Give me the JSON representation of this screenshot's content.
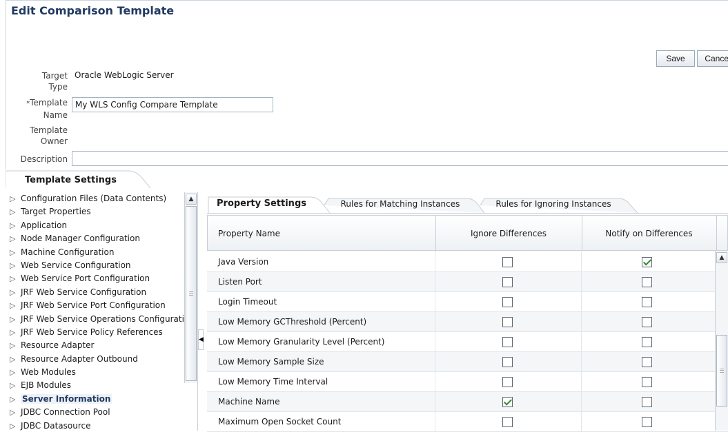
{
  "page": {
    "title": "Edit Comparison Template",
    "save_label": "Save",
    "cancel_label": "Cancel"
  },
  "form": {
    "target_type_label_1": "Target",
    "target_type_label_2": "Type",
    "target_type_value": "Oracle WebLogic Server",
    "required_mark": "*",
    "template_name_label_1": "Template",
    "template_name_label_2": "Name",
    "template_name_value": "My WLS Config Compare Template",
    "owner_label_1": "Template",
    "owner_label_2": "Owner",
    "description_label": "Description",
    "description_value": ""
  },
  "section": {
    "title": "Template Settings"
  },
  "tree": {
    "items": [
      "Configuration Files (Data Contents)",
      "Target Properties",
      "Application",
      "Node Manager Configuration",
      "Machine Configuration",
      "Web Service Configuration",
      "Web Service Port Configuration",
      "JRF Web Service Configuration",
      "JRF Web Service Port Configuration",
      "JRF Web Service Operations Configuration",
      "JRF Web Service Policy References",
      "Resource Adapter",
      "Resource Adapter Outbound",
      "Web Modules",
      "EJB Modules",
      "Server Information",
      "JDBC Connection Pool",
      "JDBC Datasource"
    ],
    "selected": "Server Information"
  },
  "tabs": [
    {
      "label": "Property Settings",
      "active": true
    },
    {
      "label": "Rules for Matching Instances",
      "active": false
    },
    {
      "label": "Rules for Ignoring Instances",
      "active": false
    }
  ],
  "grid": {
    "columns": [
      "Property Name",
      "Ignore Differences",
      "Notify on Differences"
    ],
    "rows": [
      {
        "name": "Java Version",
        "ignore": false,
        "notify": true
      },
      {
        "name": "Listen Port",
        "ignore": false,
        "notify": false
      },
      {
        "name": "Login Timeout",
        "ignore": false,
        "notify": false
      },
      {
        "name": "Low Memory GCThreshold (Percent)",
        "ignore": false,
        "notify": false
      },
      {
        "name": "Low Memory Granularity Level (Percent)",
        "ignore": false,
        "notify": false
      },
      {
        "name": "Low Memory Sample Size",
        "ignore": false,
        "notify": false
      },
      {
        "name": "Low Memory Time Interval",
        "ignore": false,
        "notify": false
      },
      {
        "name": "Machine Name",
        "ignore": true,
        "notify": false
      },
      {
        "name": "Maximum Open Socket Count",
        "ignore": false,
        "notify": false
      }
    ]
  },
  "icons": {
    "tree_expand": "triangle-right-icon",
    "scroll_up": "arrow-up-icon",
    "collapse_panel": "arrow-left-icon"
  }
}
